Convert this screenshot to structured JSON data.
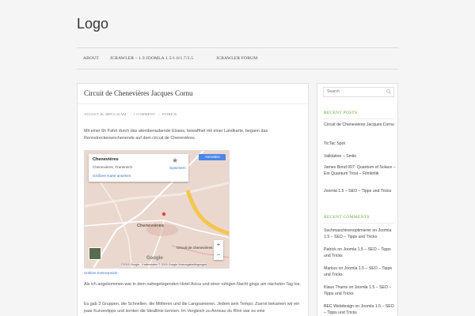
{
  "site": {
    "logo": "Logo"
  },
  "nav": {
    "items": [
      {
        "label": "About"
      },
      {
        "label": "JCrawler – 1.9 Joomla 1.5/1.6/1.7/2.5"
      },
      {
        "label": "JCrawler Forum"
      }
    ]
  },
  "post": {
    "title": "Circuit de Chenevières Jacques Cornu",
    "date": "August 26, 2009 5:44 am",
    "comments": "1 Comment",
    "author": "Patrick",
    "intro": "Mit einer 6h Fahrt durch das atemberaubende Elsass, bewaffnet mit einer Landkarte, begann das Rennstreckenwochenende auf dem circuit de Chenevières.",
    "para2": "Als ich angekommen war in dem nahegelegenden Hotel Acica und einer ruhigen Nacht gings am nächsten Tag los.",
    "para3": "Es gab 3 Gruppen, die Schnellen, die Mittleren und die Langsameren. Jedem sein Tempo. Zuerst bekamen wir ein paar Kurventipps und lernten die Ideallinie kennen. Im Vergleich zu Anneau du Rhin war es eine"
  },
  "map": {
    "place": "Chenevières",
    "subtitle": "Chenevières, Frankreich",
    "larger_map": "Größere Karte ansehen",
    "save": "Speichern",
    "sign_in": "Anmelden",
    "town_label": "Chenevières",
    "secondary_label": "Circuit de chenevières",
    "attribution": "©2015 Google - Kartendaten © 2015 Google   Nutzungsbedingungen",
    "google": "Google",
    "zoom_in": "+",
    "zoom_out": "−",
    "caption": "Größere Kartenansicht"
  },
  "sidebar": {
    "search_placeholder": "Search",
    "recent_posts_title": "Recent Posts",
    "recent_posts": [
      "Circuit de Chenevières Jacques Cornu",
      "TicTac Spot",
      "Validation – Smile",
      "James Bond 007: Quantum of Solace – Ein Quantum Trost – Filmkritik",
      "Joomla 1.5 – SEO – Tipps und Tricks"
    ],
    "recent_comments_title": "Recent Comments",
    "recent_comments": [
      "Suchmaschinenoptimierer on Joomla 1.5 – SEO – Tipps und Tricks",
      "Patrick on Joomla 1.5 – SEO – Tipps und Tricks",
      "Markus on Joomla 1.5 – SEO – Tipps und Tricks",
      "Klaus Thams on Joomla 1.5 – SEO – Tipps und Tricks",
      "BEC Webdesign on Joomla 1.5 – SEO – Tipps und Tricks"
    ]
  },
  "colors": {
    "accent": "#6aa832",
    "link": "#3a73c8"
  }
}
